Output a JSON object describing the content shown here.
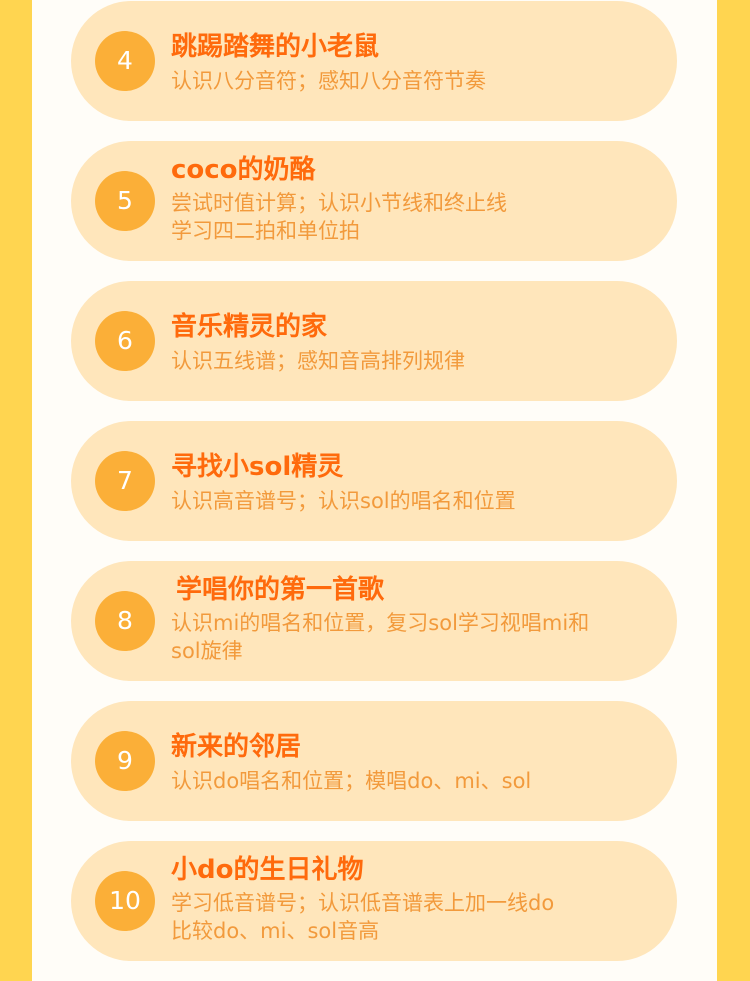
{
  "colors": {
    "page_background": "#FFD550",
    "panel_background": "#FFFDF8",
    "card_background": "#FFE6BB",
    "badge_background": "#FBAF38",
    "title_color": "#FF6A0C",
    "description_color": "#F29A3C"
  },
  "lessons": [
    {
      "number": "4",
      "title": "跳踢踏舞的小老鼠",
      "lines": [
        "认识八分音符；感知八分音符节奏"
      ]
    },
    {
      "number": "5",
      "title": "coco的奶酪",
      "lines": [
        "尝试时值计算；认识小节线和终止线",
        "学习四二拍和单位拍"
      ]
    },
    {
      "number": "6",
      "title": "音乐精灵的家",
      "lines": [
        "认识五线谱；感知音高排列规律"
      ]
    },
    {
      "number": "7",
      "title": "寻找小sol精灵",
      "lines": [
        "认识高音谱号；认识sol的唱名和位置"
      ]
    },
    {
      "number": "8",
      "title": "学唱你的第一首歌",
      "lines": [
        "认识mi的唱名和位置，复习sol学习视唱mi和",
        "sol旋律"
      ]
    },
    {
      "number": "9",
      "title": "新来的邻居",
      "lines": [
        "认识do唱名和位置；模唱do、mi、sol"
      ]
    },
    {
      "number": "10",
      "title": "小do的生日礼物",
      "lines": [
        "学习低音谱号；认识低音谱表上加一线do",
        "比较do、mi、sol音高"
      ]
    }
  ]
}
